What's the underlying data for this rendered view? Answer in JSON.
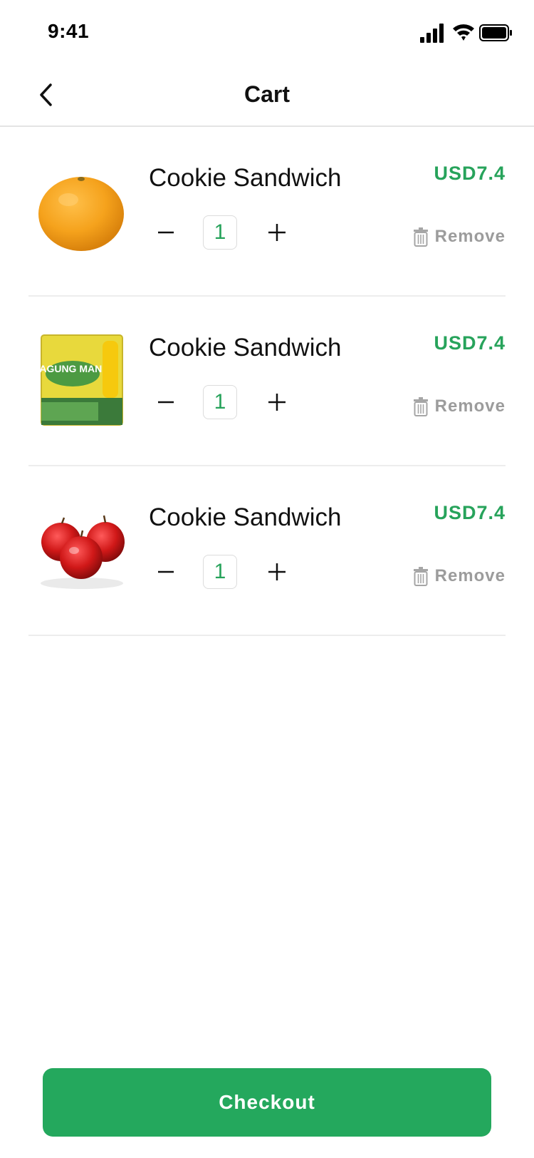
{
  "status_bar": {
    "time": "9:41"
  },
  "nav": {
    "title": "Cart"
  },
  "cart": {
    "items": [
      {
        "name": "Cookie Sandwich",
        "price": "USD7.4",
        "quantity": "1",
        "remove_label": "Remove",
        "image": "orange"
      },
      {
        "name": "Cookie Sandwich",
        "price": "USD7.4",
        "quantity": "1",
        "remove_label": "Remove",
        "image": "corn-snack-bag",
        "image_text": "JAGUNG MANIS"
      },
      {
        "name": "Cookie Sandwich",
        "price": "USD7.4",
        "quantity": "1",
        "remove_label": "Remove",
        "image": "red-apples"
      }
    ]
  },
  "checkout": {
    "label": "Checkout"
  },
  "colors": {
    "accent": "#27a35b",
    "button": "#24a85d",
    "muted": "#9c9c9c"
  }
}
